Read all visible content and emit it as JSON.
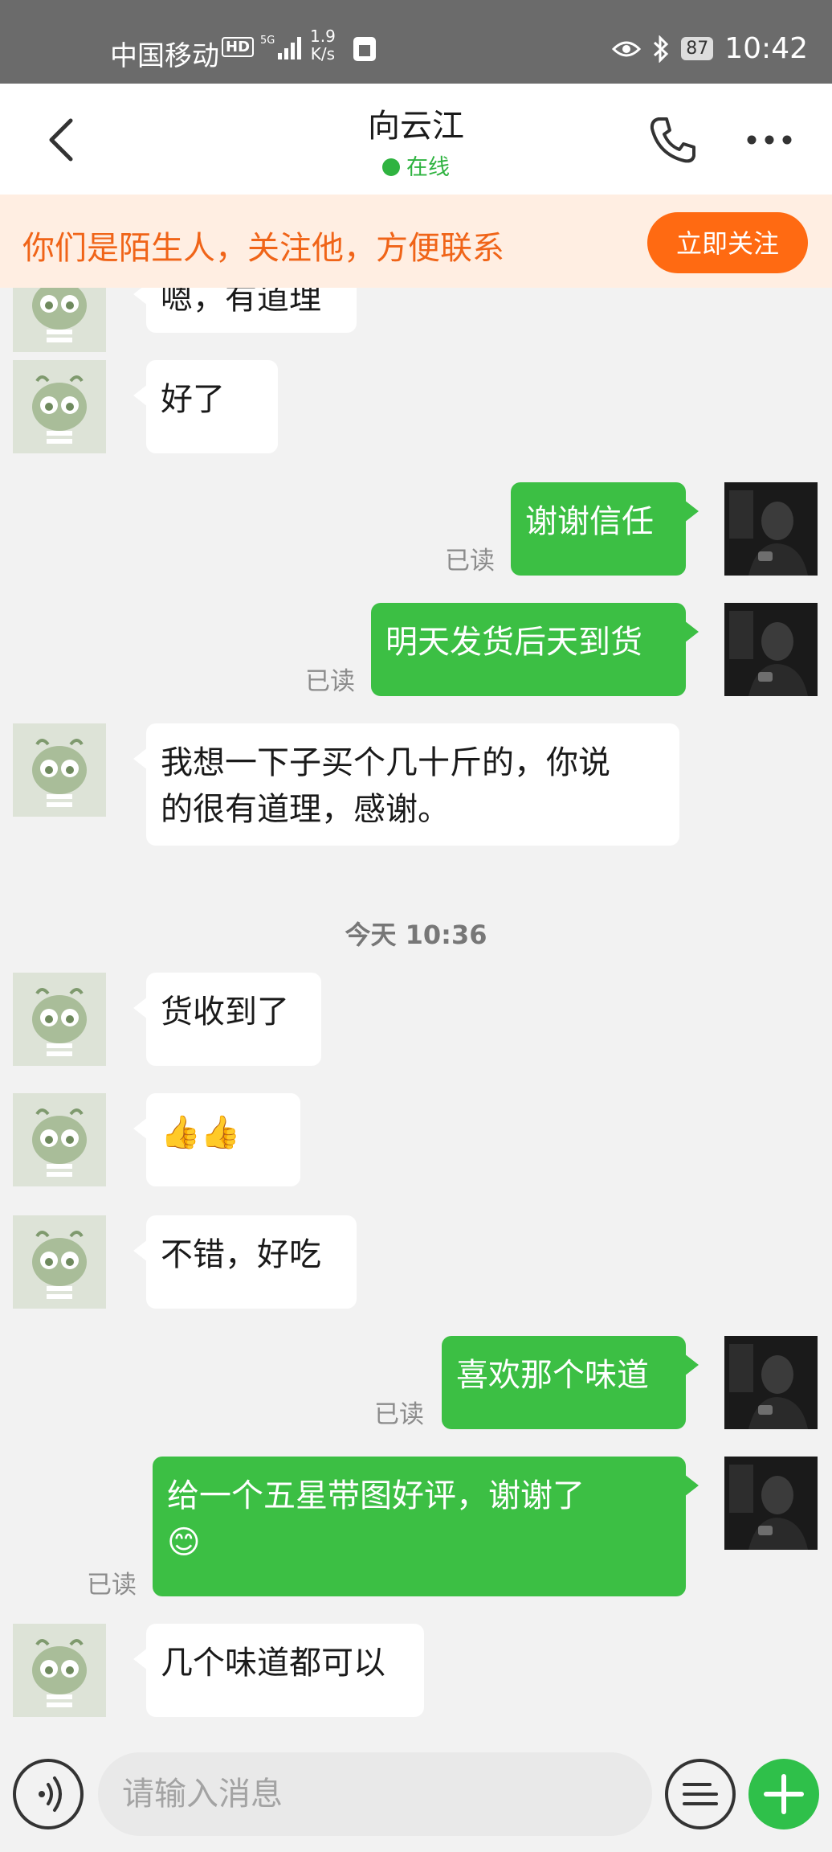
{
  "status_bar": {
    "carrier": "中国移动",
    "hd": "HD",
    "net_speed_value": "1.9",
    "net_speed_unit": "K/s",
    "battery": "87",
    "time": "10:42"
  },
  "header": {
    "title": "向云江",
    "online_status": "在线"
  },
  "banner": {
    "text": "你们是陌生人，关注他，方便联系",
    "follow_label": "立即关注"
  },
  "messages": [
    {
      "dir": "in",
      "text": "嗯，有道理"
    },
    {
      "dir": "in",
      "text": "好了"
    },
    {
      "dir": "out",
      "text": "谢谢信任",
      "read": "已读"
    },
    {
      "dir": "out",
      "text": "明天发货后天到货",
      "read": "已读"
    },
    {
      "dir": "in",
      "text": "我想一下子买个几十斤的，你说\n的很有道理，感谢。"
    },
    {
      "dir": "time",
      "text": "今天 10:36"
    },
    {
      "dir": "in",
      "text": "货收到了"
    },
    {
      "dir": "in",
      "text": "👍👍"
    },
    {
      "dir": "in",
      "text": "不错，好吃"
    },
    {
      "dir": "out",
      "text": "喜欢那个味道",
      "read": "已读"
    },
    {
      "dir": "out",
      "text": "给一个五星带图好评，谢谢了\n😊",
      "read": "已读"
    },
    {
      "dir": "in",
      "text": "几个味道都可以"
    }
  ],
  "input": {
    "placeholder": "请输入消息"
  },
  "colors": {
    "accent_green": "#3cbf44",
    "follow_orange": "#ff6a12",
    "banner_bg": "#ffeee2"
  }
}
